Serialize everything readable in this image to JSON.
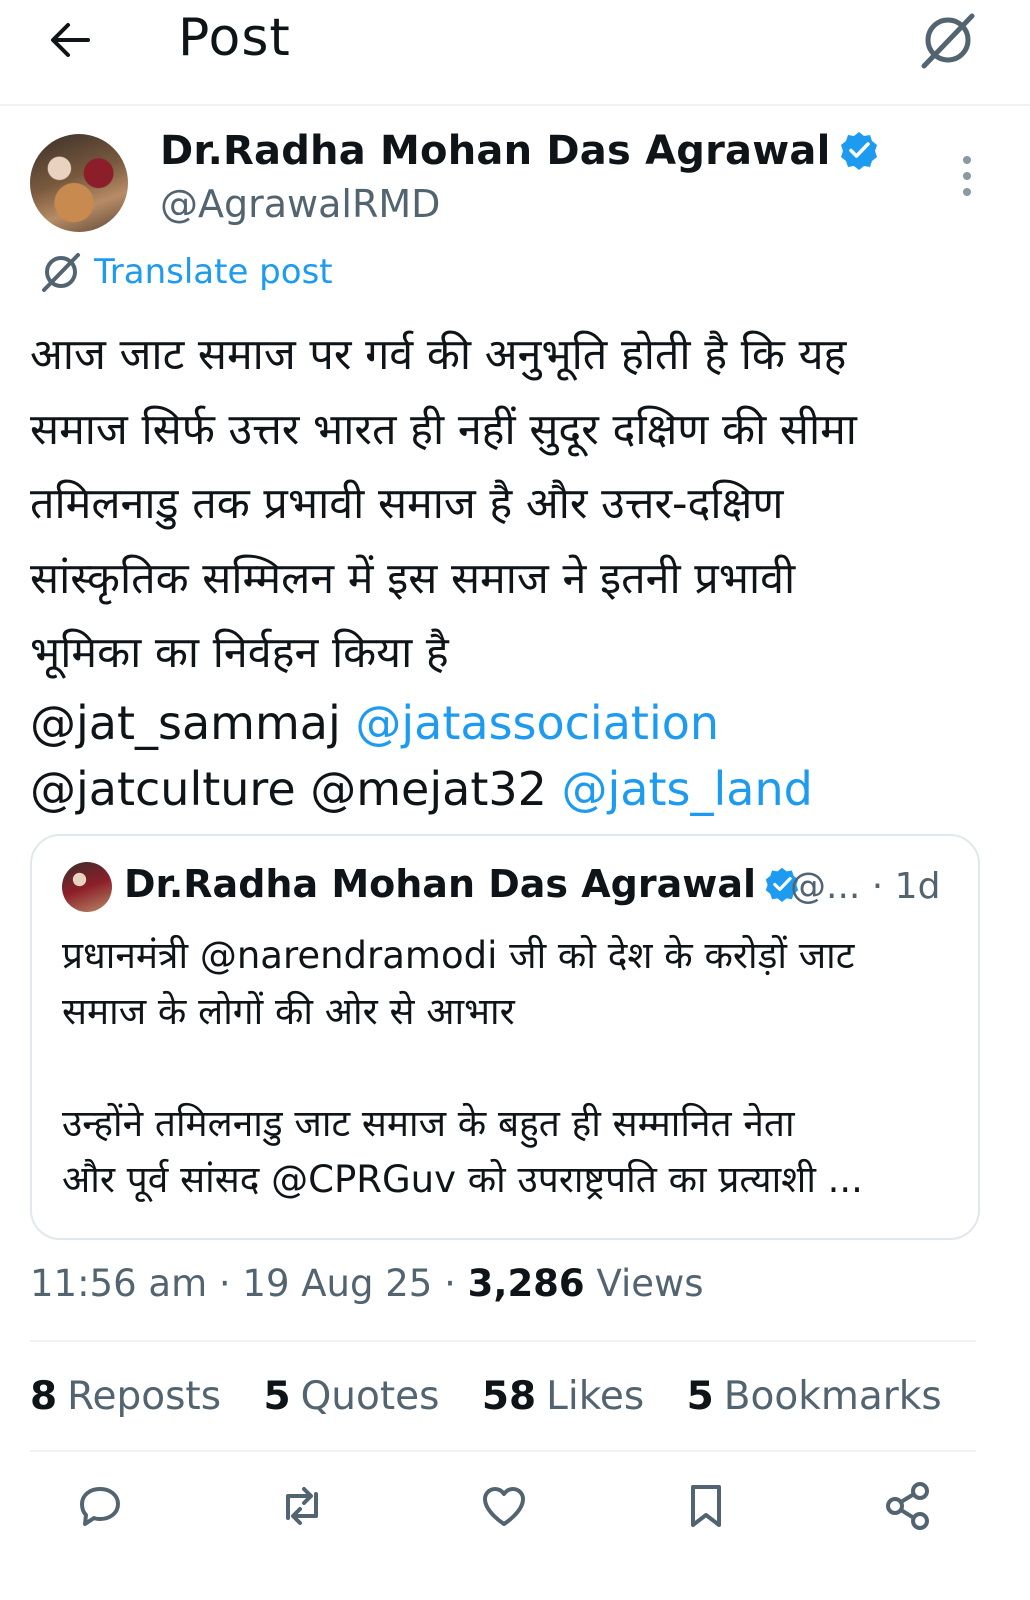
{
  "header": {
    "title": "Post"
  },
  "author": {
    "name": "Dr.Radha Mohan Das Agrawal",
    "handle": "@AgrawalRMD"
  },
  "translate_label": "Translate post",
  "post": {
    "text": "आज जाट समाज पर गर्व की अनुभूति होती है कि यह\nसमाज सिर्फ उत्तर भारत ही नहीं सुदूर दक्षिण की सीमा\nतमिलनाडु तक प्रभावी समाज है और उत्तर-दक्षिण\nसांस्कृतिक सम्मिलन में इस समाज ने इतनी प्रभावी\nभूमिका का निर्वहन किया है",
    "mentions": [
      {
        "text": "@jat_sammaj",
        "linked": false
      },
      {
        "text": "@jatassociation",
        "linked": true
      },
      {
        "text": "@jatculture",
        "linked": false
      },
      {
        "text": "@mejat32",
        "linked": false
      },
      {
        "text": "@jats_land",
        "linked": true
      }
    ]
  },
  "quote": {
    "name": "Dr.Radha Mohan Das Agrawal",
    "handle": "@...",
    "time": "· 1d",
    "text": "प्रधानमंत्री @narendramodi जी को देश के करोड़ों जाट\nसमाज के लोगों की ओर से आभार\n\nउन्होंने तमिलनाडु जाट समाज के बहुत ही सम्मानित नेता\nऔर पूर्व सांसद @CPRGuv को उपराष्ट्रपति का प्रत्याशी ..."
  },
  "meta": {
    "time": "11:56 am",
    "date": "19 Aug 25",
    "views_count": "3,286",
    "views_label": "Views"
  },
  "stats": [
    {
      "count": "8",
      "label": "Reposts"
    },
    {
      "count": "5",
      "label": "Quotes"
    },
    {
      "count": "58",
      "label": "Likes"
    },
    {
      "count": "5",
      "label": "Bookmarks"
    }
  ],
  "colors": {
    "link": "#1d9bf0",
    "secondary": "#536471",
    "text": "#0f1419"
  }
}
